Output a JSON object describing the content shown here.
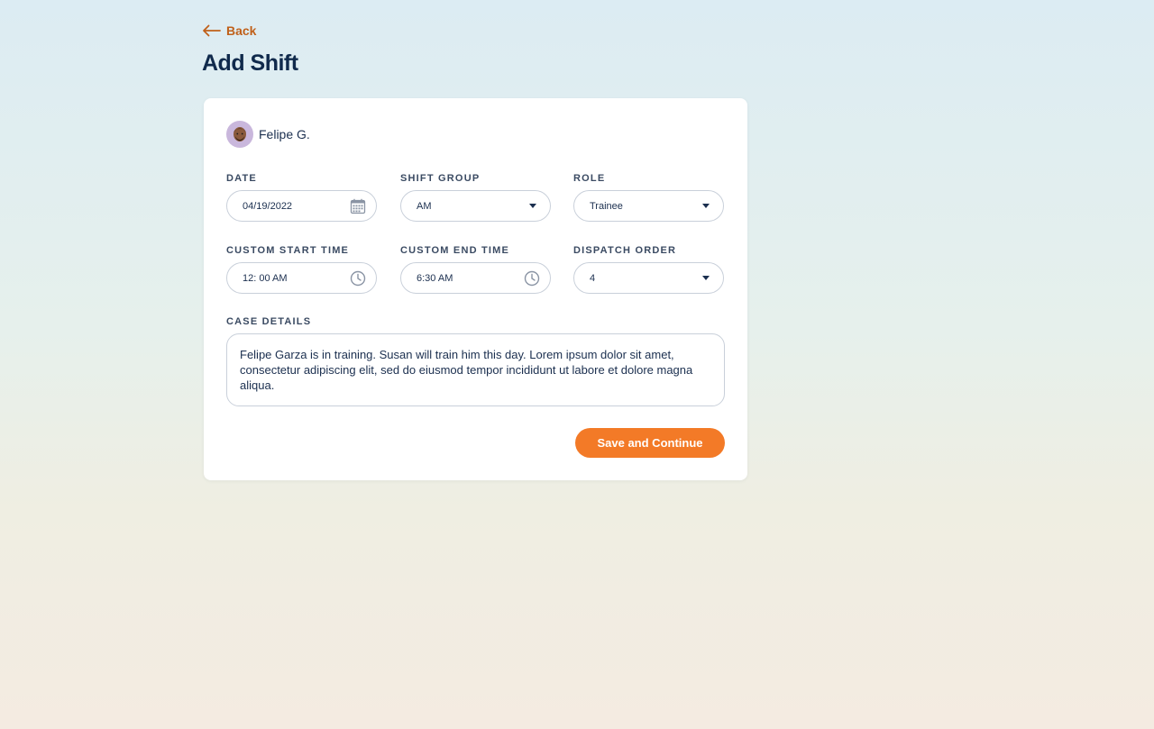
{
  "header": {
    "back_label": "Back",
    "title": "Add Shift"
  },
  "user": {
    "name": "Felipe G."
  },
  "form": {
    "date": {
      "label": "DATE",
      "value": "04/19/2022",
      "icon": "calendar-icon"
    },
    "shift_group": {
      "label": "SHIFT GROUP",
      "value": "AM"
    },
    "role": {
      "label": "ROLE",
      "value": "Trainee"
    },
    "start_time": {
      "label": "CUSTOM START TIME",
      "value": "12: 00 AM",
      "icon": "clock-icon"
    },
    "end_time": {
      "label": "CUSTOM END TIME",
      "value": "6:30 AM",
      "icon": "clock-icon"
    },
    "dispatch_order": {
      "label": "DISPATCH ORDER",
      "value": "4"
    },
    "case_details": {
      "label": "CASE DETAILS",
      "value": "Felipe Garza is in training. Susan will train him this day. Lorem ipsum dolor sit amet, consectetur adipiscing elit, sed do eiusmod tempor incididunt ut labore et dolore magna aliqua."
    }
  },
  "actions": {
    "save_label": "Save and Continue"
  },
  "colors": {
    "accent": "#f37a27",
    "back_link": "#c0601a",
    "title": "#102a4c",
    "border": "#c9d0da",
    "avatar_bg": "#c9b7dc"
  }
}
